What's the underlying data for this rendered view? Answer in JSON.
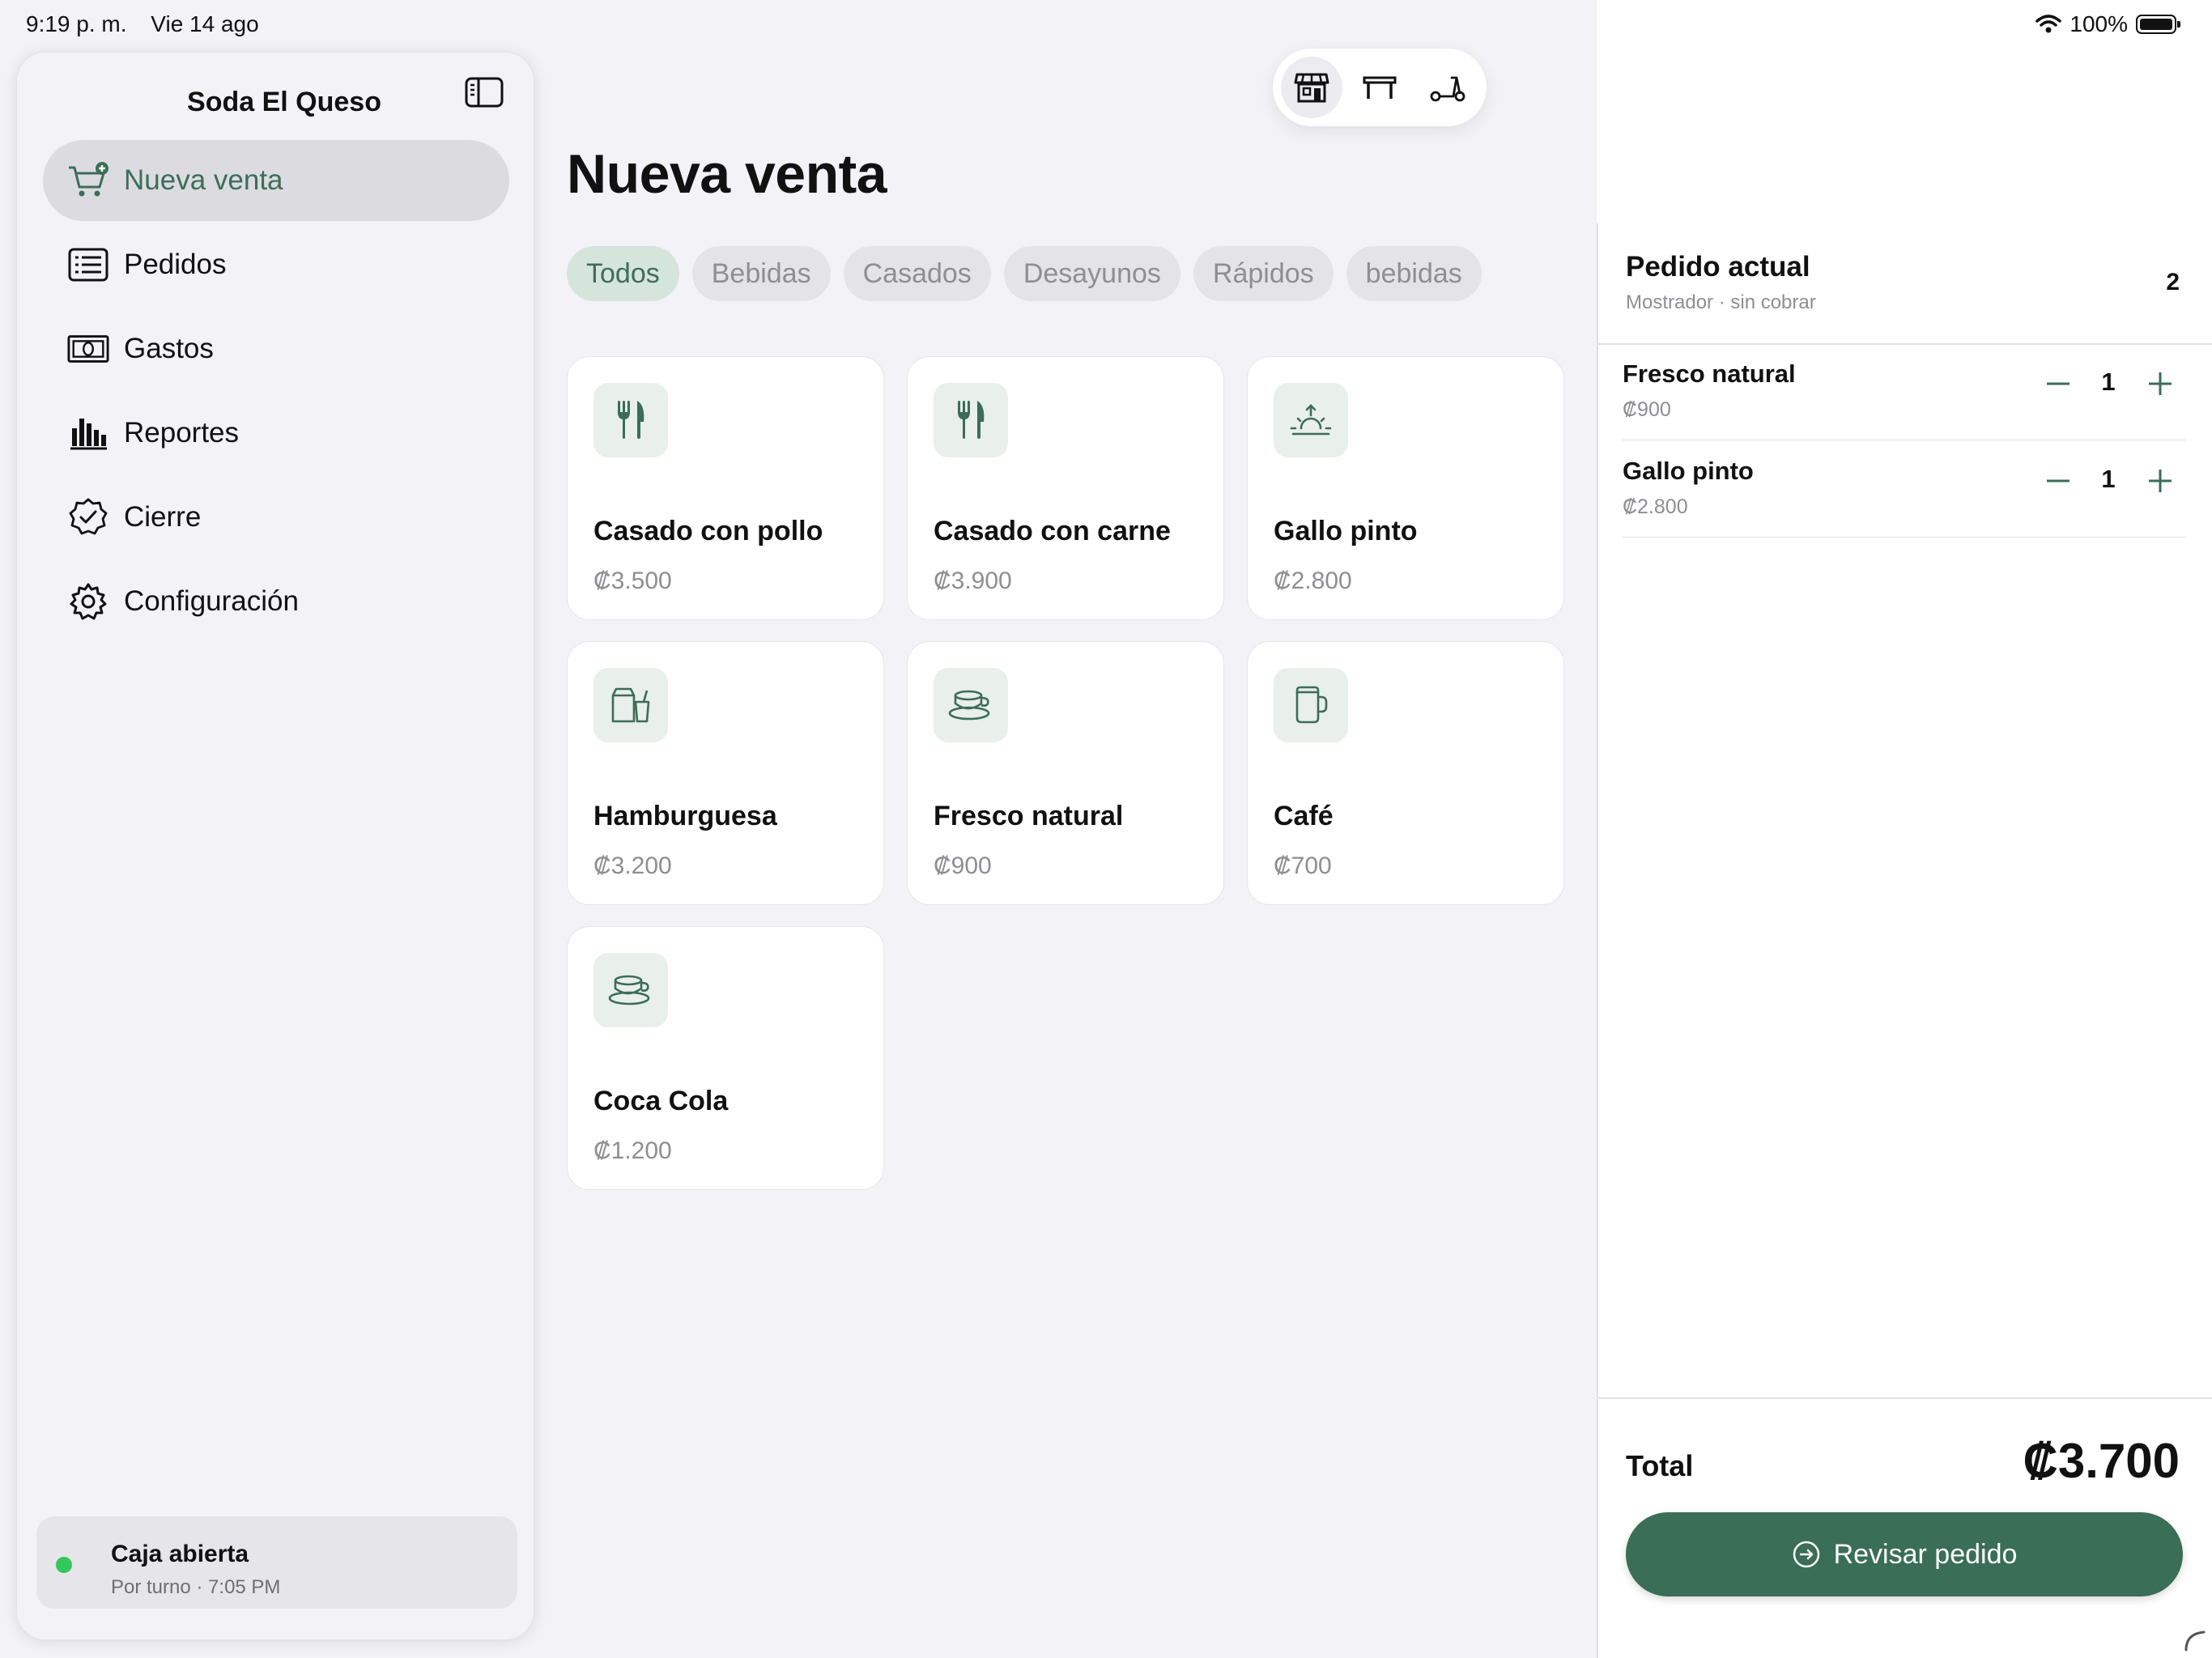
{
  "status_bar": {
    "time": "9:19 p. m.",
    "date": "Vie 14 ago",
    "battery": "100%"
  },
  "sidebar": {
    "title": "Soda El Queso",
    "items": [
      {
        "label": "Nueva venta",
        "icon": "cart-plus-icon",
        "active": true
      },
      {
        "label": "Pedidos",
        "icon": "list-icon"
      },
      {
        "label": "Gastos",
        "icon": "banknote-icon"
      },
      {
        "label": "Reportes",
        "icon": "bar-chart-icon"
      },
      {
        "label": "Cierre",
        "icon": "checkmark-seal-icon"
      },
      {
        "label": "Configuración",
        "icon": "gear-icon"
      }
    ],
    "register": {
      "status": "Caja abierta",
      "detail": "Por turno · 7:05 PM"
    }
  },
  "order_modes": [
    "store-icon",
    "table-icon",
    "scooter-icon"
  ],
  "main": {
    "title": "Nueva venta",
    "categories": [
      "Todos",
      "Bebidas",
      "Casados",
      "Desayunos",
      "Rápidos",
      "bebidas"
    ],
    "products": [
      {
        "name": "Casado con pollo",
        "price": "₡3.500",
        "icon": "fork-knife-icon"
      },
      {
        "name": "Casado con carne",
        "price": "₡3.900",
        "icon": "fork-knife-icon"
      },
      {
        "name": "Gallo pinto",
        "price": "₡2.800",
        "icon": "sunrise-icon"
      },
      {
        "name": "Hamburguesa",
        "price": "₡3.200",
        "icon": "takeout-bag-icon"
      },
      {
        "name": "Fresco natural",
        "price": "₡900",
        "icon": "cup-saucer-icon"
      },
      {
        "name": "Café",
        "price": "₡700",
        "icon": "mug-icon"
      },
      {
        "name": "Coca Cola",
        "price": "₡1.200",
        "icon": "cup-saucer-icon"
      }
    ]
  },
  "order": {
    "title": "Pedido actual",
    "subtitle": "Mostrador · sin cobrar",
    "count": "2",
    "items": [
      {
        "name": "Fresco natural",
        "price": "₡900",
        "qty": "1"
      },
      {
        "name": "Gallo pinto",
        "price": "₡2.800",
        "qty": "1"
      }
    ],
    "total_label": "Total",
    "total": "₡3.700",
    "review_label": "Revisar pedido"
  },
  "colors": {
    "accent": "#3a6e56",
    "accent_light": "#d6e5dc",
    "status_green": "#34c759"
  }
}
